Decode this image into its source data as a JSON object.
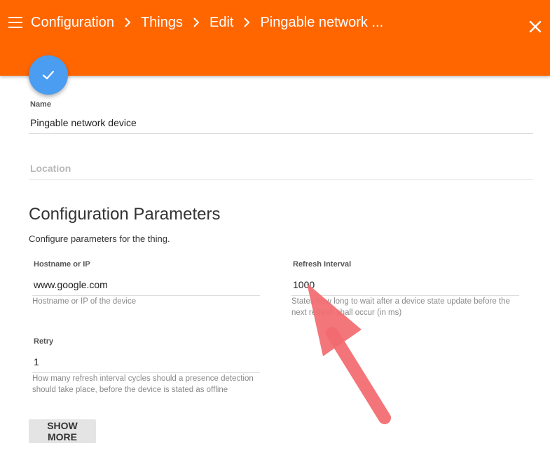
{
  "header": {
    "breadcrumb": [
      "Configuration",
      "Things",
      "Edit",
      "Pingable network ..."
    ],
    "accent": "#ff6600"
  },
  "icons": {
    "menu": "menu-icon",
    "close": "close-icon",
    "fab": "check-icon",
    "separator": "chevron-right-icon"
  },
  "form": {
    "name_label": "Name",
    "name_value": "Pingable network device",
    "location_placeholder": "Location"
  },
  "config": {
    "title": "Configuration Parameters",
    "description": "Configure parameters for the thing.",
    "hostname": {
      "label": "Hostname or IP",
      "value": "www.google.com",
      "help": "Hostname or IP of the device"
    },
    "refresh": {
      "label": "Refresh Interval",
      "value": "1000",
      "help_line1": "States how long to wait after a device state update before the",
      "help_line2": "next refresh shall occur (in ms)"
    },
    "retry": {
      "label": "Retry",
      "value": "1",
      "help_line1": "How many refresh interval cycles should a presence detection",
      "help_line2": "should take place, before the device is stated as offline"
    },
    "show_more_label": "SHOW MORE"
  },
  "colors": {
    "fab": "#4a9df0",
    "annotation_arrow": "#f26a6f"
  }
}
